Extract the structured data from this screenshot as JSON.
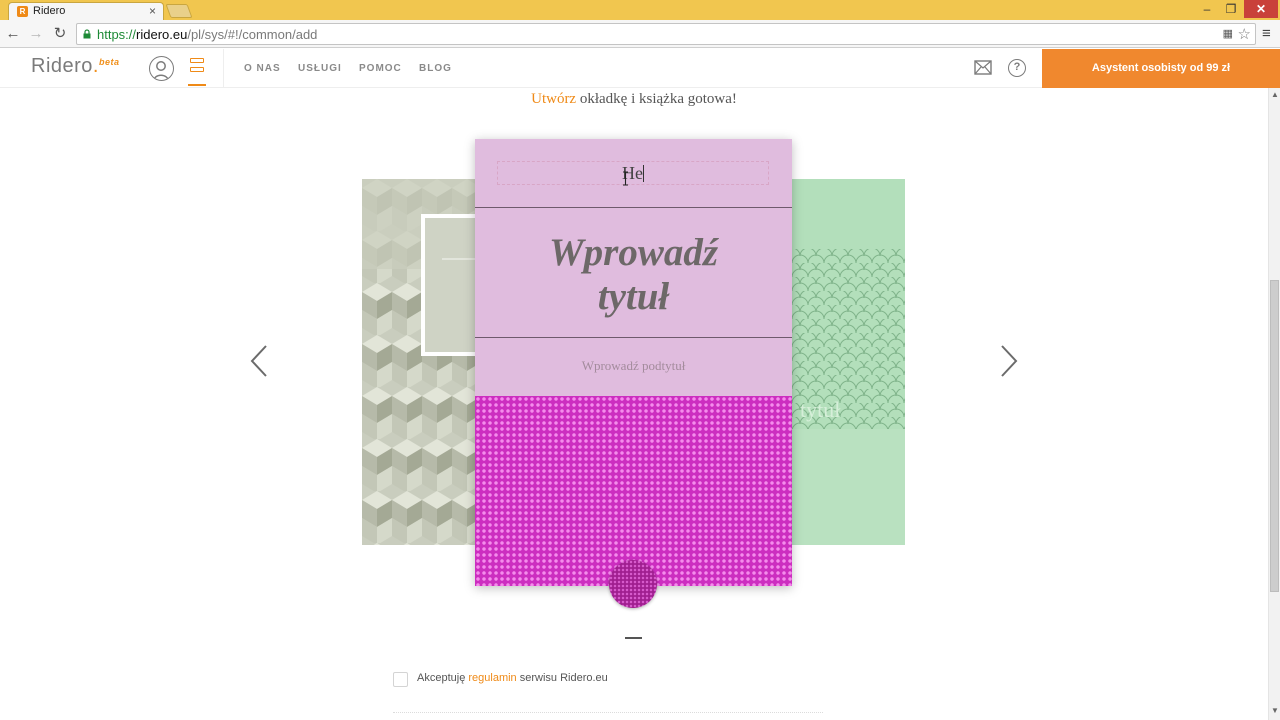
{
  "browser": {
    "tab_title": "Ridero",
    "favicon": "ridero-favicon",
    "url_scheme": "https://",
    "url_host": "ridero.eu",
    "url_path": "/pl/sys/#!/common/add",
    "close_symbol": "×"
  },
  "header": {
    "logo": "Ridero",
    "logo_dot": ".",
    "logo_badge": "beta",
    "nav": [
      {
        "label": "O NAS"
      },
      {
        "label": "USŁUGI"
      },
      {
        "label": "POMOC"
      },
      {
        "label": "BLOG"
      }
    ],
    "assistant_button": "Asystent osobisty od 99 zł",
    "help_symbol": "?"
  },
  "main": {
    "headline_accent": "Utwórz",
    "headline_rest": " okładkę i książka gotowa!",
    "cover": {
      "author_value": "He",
      "title_line1": "Wprowadź",
      "title_line2": "tytuł",
      "subtitle_placeholder": "Wprowadź podtytuł",
      "background_color": "#e0bcde",
      "pattern_color": "#cc2ec0"
    },
    "side_cover_right_title": "tytuł",
    "terms": {
      "prefix": "Akceptuję ",
      "link": "regulamin",
      "suffix": " serwisu Ridero.eu"
    }
  }
}
